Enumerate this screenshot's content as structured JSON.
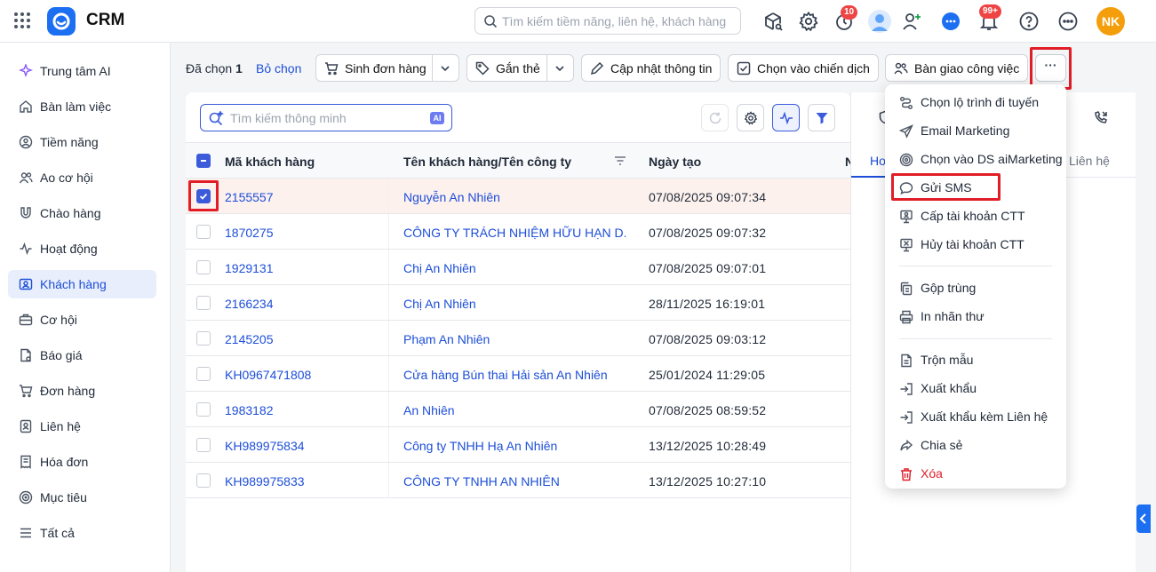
{
  "app": {
    "title": "CRM",
    "avatar_initials": "NK"
  },
  "search": {
    "placeholder": "Tìm kiếm tiềm năng, liên hệ, khách hàng"
  },
  "badges": {
    "timer": "10",
    "notifications": "99+"
  },
  "sidebar": {
    "items": [
      {
        "label": "Trung tâm AI",
        "icon": "sparkle-icon"
      },
      {
        "label": "Bàn làm việc",
        "icon": "home-icon"
      },
      {
        "label": "Tiềm năng",
        "icon": "user-circle-icon"
      },
      {
        "label": "Ao cơ hội",
        "icon": "users-icon"
      },
      {
        "label": "Chào hàng",
        "icon": "magnet-icon"
      },
      {
        "label": "Hoạt động",
        "icon": "activity-icon"
      },
      {
        "label": "Khách hàng",
        "icon": "contact-card-icon",
        "active": true
      },
      {
        "label": "Cơ hội",
        "icon": "briefcase-icon"
      },
      {
        "label": "Báo giá",
        "icon": "quote-icon"
      },
      {
        "label": "Đơn hàng",
        "icon": "cart-icon"
      },
      {
        "label": "Liên hệ",
        "icon": "contact-icon"
      },
      {
        "label": "Hóa đơn",
        "icon": "invoice-icon"
      },
      {
        "label": "Mục tiêu",
        "icon": "target-icon"
      },
      {
        "label": "Tất cả",
        "icon": "menu-icon"
      }
    ]
  },
  "actionbar": {
    "selected_label": "Đã chọn",
    "selected_count": "1",
    "deselect": "Bỏ chọn",
    "create_order": "Sinh đơn hàng",
    "tag": "Gắn thẻ",
    "update_info": "Cập nhật thông tin",
    "add_to_campaign": "Chọn vào chiến dịch",
    "handover": "Bàn giao công việc",
    "more": "···"
  },
  "toolbar": {
    "smart_search_placeholder": "Tìm kiếm thông minh",
    "ai_chip": "AI"
  },
  "table": {
    "columns": [
      "Mã khách hàng",
      "Tên khách hàng/Tên công ty",
      "Ngày tạo",
      "N"
    ],
    "rows": [
      {
        "code": "2155557",
        "name": "Nguyễn An Nhiên",
        "created": "07/08/2025 09:07:34",
        "checked": true
      },
      {
        "code": "1870275",
        "name": "CÔNG TY TRÁCH NHIỆM HỮU HẠN D...",
        "created": "07/08/2025 09:07:32",
        "checked": false
      },
      {
        "code": "1929131",
        "name": "Chị An Nhiên",
        "created": "07/08/2025 09:07:01",
        "checked": false
      },
      {
        "code": "2166234",
        "name": "Chị An Nhiên",
        "created": "28/11/2025 16:19:01",
        "checked": false
      },
      {
        "code": "2145205",
        "name": "Phạm An Nhiên",
        "created": "07/08/2025 09:03:12",
        "checked": false
      },
      {
        "code": "KH0967471808",
        "name": "Cửa hàng Bún thai Hải sản An Nhiên",
        "created": "25/01/2024 11:29:05",
        "checked": false
      },
      {
        "code": "1983182",
        "name": "An Nhiên",
        "created": "07/08/2025 08:59:52",
        "checked": false
      },
      {
        "code": "KH989975834",
        "name": "Công ty TNHH Hạ An Nhiên",
        "created": "13/12/2025 10:28:49",
        "checked": false
      },
      {
        "code": "KH989975833",
        "name": "CÔNG TY TNHH AN NHIÊN",
        "created": "13/12/2025 10:27:10",
        "checked": false
      }
    ]
  },
  "right_panel": {
    "tabs": [
      "Ho",
      "Liên hệ"
    ]
  },
  "dropdown": {
    "items": [
      {
        "label": "Chọn lộ trình đi tuyến",
        "icon": "route-icon"
      },
      {
        "label": "Email Marketing",
        "icon": "send-icon"
      },
      {
        "label": "Chọn vào DS aiMarketing",
        "icon": "target-ring-icon"
      },
      {
        "label": "Gửi SMS",
        "icon": "chat-bubble-icon"
      },
      {
        "label": "Cấp tài khoản CTT",
        "icon": "account-grant-icon"
      },
      {
        "label": "Hủy tài khoản CTT",
        "icon": "account-revoke-icon"
      },
      {
        "label": "Gộp trùng",
        "icon": "merge-copy-icon"
      },
      {
        "label": "In nhãn thư",
        "icon": "printer-icon"
      },
      {
        "label": "Trộn mẫu",
        "icon": "document-icon"
      },
      {
        "label": "Xuất khẩu",
        "icon": "export-icon"
      },
      {
        "label": "Xuất khẩu kèm Liên hệ",
        "icon": "export-contact-icon"
      },
      {
        "label": "Chia sẻ",
        "icon": "share-icon"
      },
      {
        "label": "Xóa",
        "icon": "trash-icon"
      }
    ]
  },
  "colors": {
    "brand": "#1d6ff2",
    "link": "#1d4ed8",
    "highlight": "#e11d27",
    "selected_row": "#fdf1ee"
  }
}
